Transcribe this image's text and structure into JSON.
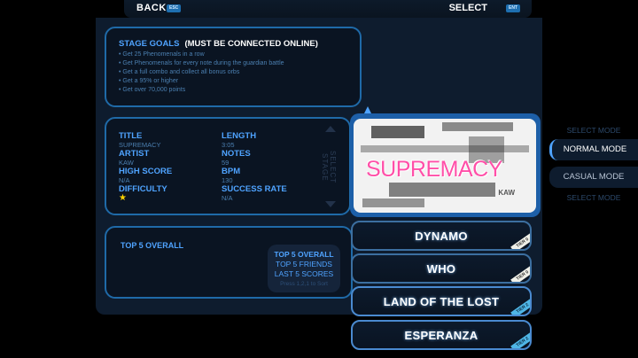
{
  "topbar": {
    "back_label": "BACK",
    "back_key": "ESC",
    "select_label": "SELECT",
    "select_key": "ENT"
  },
  "goals": {
    "heading": "STAGE GOALS",
    "heading_note": "(MUST BE CONNECTED ONLINE)",
    "items": [
      "Get 25 Phenomenals in a row",
      "Get Phenomenals for every note during the guardian battle",
      "Get a full combo and collect all bonus orbs",
      "Get a 95% or higher",
      "Get over 70,000 points"
    ]
  },
  "song_info": {
    "title_label": "TITLE",
    "title_value": "SUPREMACY",
    "length_label": "LENGTH",
    "length_value": "3:05",
    "artist_label": "ARTIST",
    "artist_value": "KAW",
    "notes_label": "NOTES",
    "notes_value": "59",
    "high_score_label": "HIGH SCORE",
    "high_score_value": "N/A",
    "bpm_label": "BPM",
    "bpm_value": "130",
    "difficulty_label": "DIFFICULTY",
    "difficulty_stars": "★",
    "success_rate_label": "SUCCESS RATE",
    "success_rate_value": "N/A",
    "select_stage": "SELECT STAGE"
  },
  "top5": {
    "title": "TOP 5 OVERALL",
    "options": [
      "TOP 5 OVERALL",
      "TOP 5 FRIENDS",
      "LAST 5 SCORES"
    ],
    "hint": "Press 1,2,1 to Sort"
  },
  "album": {
    "logo": "SUPREMACY",
    "sub": "KAW"
  },
  "songs": [
    {
      "name": "DYNAMO",
      "tier": "TIER 0"
    },
    {
      "name": "WHO",
      "tier": "TIER 0"
    },
    {
      "name": "LAND OF THE LOST",
      "tier": "TIER 2"
    },
    {
      "name": "ESPERANZA",
      "tier": "TIER 2"
    }
  ],
  "modes": {
    "select_mode": "SELECT MODE",
    "normal": "NORMAL MODE",
    "casual": "CASUAL MODE"
  },
  "colors": {
    "accent": "#4fa3ff",
    "panel": "#0e1c2e",
    "star": "#ffd400"
  }
}
